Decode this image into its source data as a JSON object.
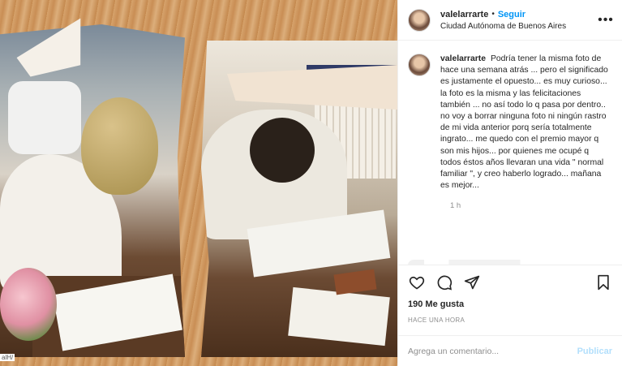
{
  "post": {
    "username": "valelarrarte",
    "follow_label": "Seguir",
    "separator": "•",
    "location": "Ciudad Autónoma de Buenos Aires",
    "more_label": "•••"
  },
  "caption": {
    "username": "valelarrarte",
    "text": "Podría tener la misma foto de hace una semana atrás ... pero el significado es justamente el opuesto... es muy curioso... la foto es la misma y las felicitaciones también ... no así todo lo q pasa por dentro.. no voy a borrar ninguna foto ni ningún rastro de mi vida anterior porq sería totalmente ingrato... me quedo con el premio mayor q son mis hijos... por quienes me ocupé q todos éstos años llevaran una vida \" normal familiar \", y creo haberlo logrado... mañana es mejor...",
    "time": "1 h"
  },
  "actions": {
    "icons": [
      "heart-icon",
      "comment-icon",
      "share-icon",
      "bookmark-icon"
    ],
    "likes": "190 Me gusta",
    "posted_ago": "HACE UNA HORA"
  },
  "comment_box": {
    "placeholder": "Agrega un comentario...",
    "publish_label": "Publicar"
  },
  "photo": {
    "watermark": "alH/"
  },
  "colors": {
    "link_blue": "#0095f6",
    "publish_disabled": "#b2dffc",
    "muted": "#8e8e8e",
    "border": "#efefef"
  }
}
